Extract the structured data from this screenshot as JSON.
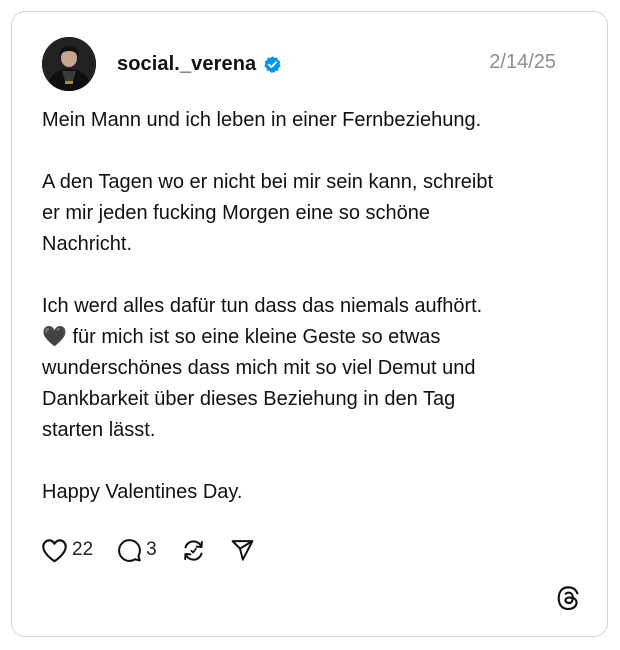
{
  "post": {
    "username": "social._verena",
    "verified": true,
    "date": "2/14/25",
    "paragraphs": [
      "Mein Mann und ich leben in einer Fernbeziehung.",
      "A den Tagen wo er nicht bei mir sein kann, schreibt\ner mir jeden fucking Morgen eine so schöne\nNachricht.",
      "Ich werd alles dafür tun dass das niemals aufhört.\n🖤 für mich ist so eine kleine Geste so etwas\nwunderschönes dass mich mit so viel Demut und\nDankbarkeit über dieses Beziehung in den Tag\nstarten lässt.",
      "Happy Valentines Day."
    ]
  },
  "actions": {
    "like_count": "22",
    "reply_count": "3"
  },
  "icons": {
    "like": "heart-icon",
    "reply": "comment-bubble-icon",
    "repost": "repost-icon",
    "share": "send-icon",
    "verified": "verified-badge-icon",
    "brand": "threads-logo-icon"
  },
  "colors": {
    "verified_blue": "#0095f6",
    "date_gray": "#8e8e8e",
    "border": "#d6d6d6"
  }
}
